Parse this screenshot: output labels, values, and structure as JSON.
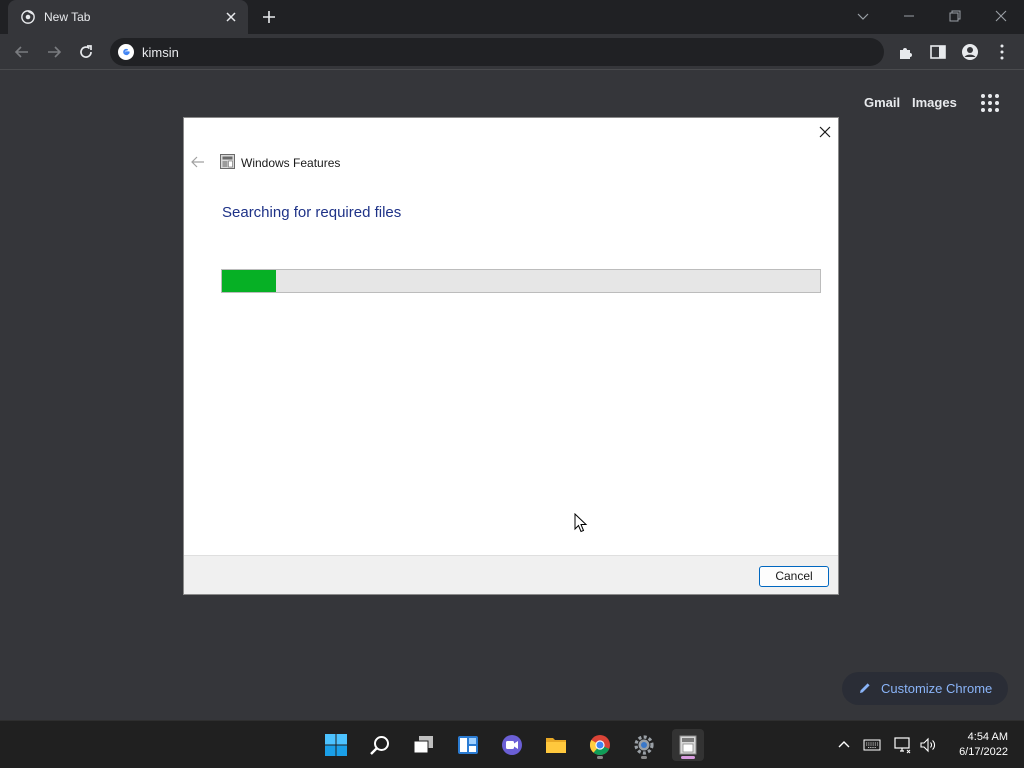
{
  "browser": {
    "tab_title": "New Tab",
    "address": "kimsin",
    "ntp_links": {
      "gmail": "Gmail",
      "images": "Images"
    },
    "customize_label": "Customize Chrome"
  },
  "dialog": {
    "title": "Windows Features",
    "heading": "Searching for required files",
    "progress_fraction": 0.09,
    "cancel_label": "Cancel"
  },
  "taskbar": {
    "apps": [
      "start-icon",
      "search-icon",
      "task-view-icon",
      "widgets-icon",
      "chat-icon",
      "file-explorer-icon",
      "chrome-icon",
      "settings-icon",
      "windows-features-icon"
    ],
    "time": "4:54 AM",
    "date": "6/17/2022"
  },
  "colors": {
    "progress_green": "#06b025",
    "heading_blue": "#1e3287",
    "link_blue": "#8ab4f8"
  }
}
